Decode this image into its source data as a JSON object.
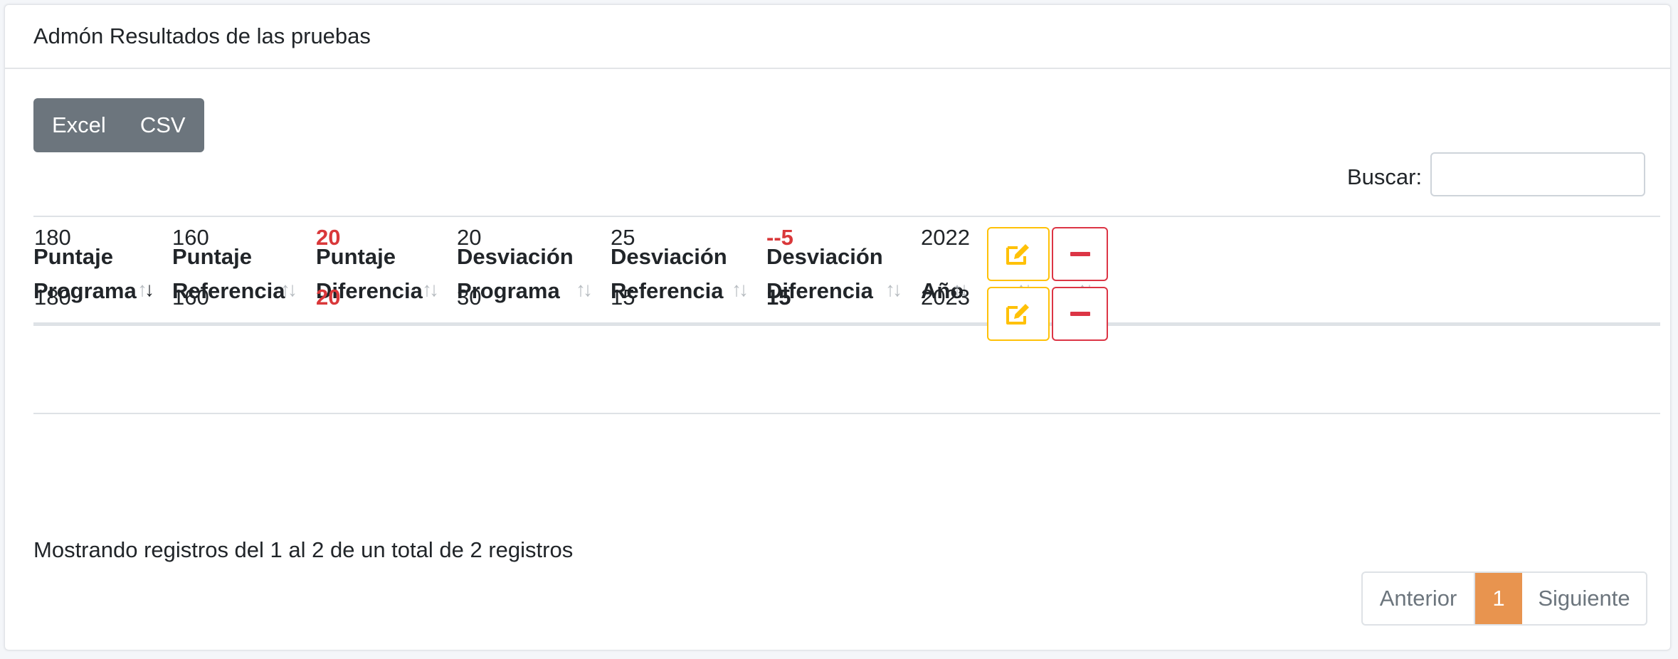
{
  "card": {
    "title": "Admón Resultados de las pruebas"
  },
  "export": {
    "excel": "Excel",
    "csv": "CSV"
  },
  "search": {
    "label": "Buscar:",
    "value": "",
    "placeholder": ""
  },
  "table": {
    "columns": [
      {
        "line1": "Puntaje",
        "line2": "Programa",
        "sort": "descending"
      },
      {
        "line1": "Puntaje",
        "line2": "Referencia",
        "sort": "none"
      },
      {
        "line1": "Puntaje",
        "line2": "Diferencia",
        "sort": "none"
      },
      {
        "line1": "Desviación",
        "line2": "Programa",
        "sort": "none"
      },
      {
        "line1": "Desviación",
        "line2": "Referencia",
        "sort": "none"
      },
      {
        "line1": "Desviación",
        "line2": "Diferencia",
        "sort": "none"
      },
      {
        "line1": "",
        "line2": "Año",
        "sort": "none"
      },
      {
        "line1": "",
        "line2": "",
        "sort": "none"
      },
      {
        "line1": "",
        "line2": "",
        "sort": "none"
      }
    ],
    "rows": [
      {
        "puntaje_programa": "180",
        "puntaje_referencia": "160",
        "puntaje_diferencia": "20",
        "desviacion_programa": "20",
        "desviacion_referencia": "25",
        "desviacion_diferencia": "--5",
        "anio": "2022",
        "edit_icon": "edit-icon",
        "delete_icon": "minus-icon"
      },
      {
        "puntaje_programa": "180",
        "puntaje_referencia": "160",
        "puntaje_diferencia": "20",
        "desviacion_programa": "30",
        "desviacion_referencia": "15",
        "desviacion_diferencia": "15",
        "anio": "2023",
        "edit_icon": "edit-icon",
        "delete_icon": "minus-icon"
      }
    ]
  },
  "footer": {
    "info": "Mostrando registros del 1 al 2 de un total de 2 registros"
  },
  "pagination": {
    "previous": "Anterior",
    "current": "1",
    "next": "Siguiente"
  },
  "colors": {
    "secondary": "#6c757d",
    "warning": "#ffc107",
    "danger": "#dc3545",
    "negative_text": "#d9383a",
    "active_page": "#e8944f"
  }
}
